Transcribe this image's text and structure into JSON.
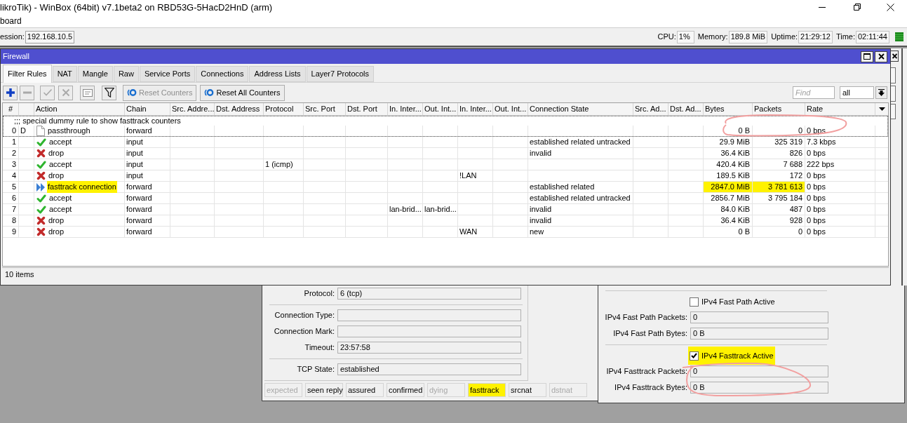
{
  "app_window": {
    "title": "likroTik) - WinBox (64bit) v7.1beta2 on RBD53G-5HacD2HnD (arm)"
  },
  "menu": [
    "board"
  ],
  "session_bar": {
    "label": "ession:",
    "value": "192.168.10.5",
    "stats": [
      {
        "label": "CPU:",
        "value": "1%"
      },
      {
        "label": "Memory:",
        "value": "189.8 MiB"
      },
      {
        "label": "Uptime:",
        "value": "21:29:12"
      },
      {
        "label": "Time:",
        "value": "02:11:44"
      }
    ]
  },
  "firewall": {
    "title": "Firewall",
    "tabs": [
      {
        "label": "Filter Rules",
        "selected": true
      },
      {
        "label": "NAT",
        "selected": false
      },
      {
        "label": "Mangle",
        "selected": false
      },
      {
        "label": "Raw",
        "selected": false
      },
      {
        "label": "Service Ports",
        "selected": false
      },
      {
        "label": "Connections",
        "selected": false
      },
      {
        "label": "Address Lists",
        "selected": false
      },
      {
        "label": "Layer7 Protocols",
        "selected": false
      }
    ],
    "toolbar": {
      "icon_buttons": [
        {
          "kind": "add",
          "disabled": false
        },
        {
          "kind": "remove",
          "disabled": true
        },
        {
          "kind": "enable",
          "disabled": true
        },
        {
          "kind": "disable",
          "disabled": true
        },
        {
          "kind": "comment",
          "disabled": true
        },
        {
          "kind": "filter",
          "disabled": false
        }
      ],
      "text_buttons": [
        {
          "label": "Reset Counters",
          "disabled": true
        },
        {
          "label": "Reset All Counters",
          "disabled": false
        }
      ],
      "find": {
        "placeholder": "Find"
      },
      "filter_select": {
        "value": "all"
      }
    },
    "table": {
      "columns": [
        "#",
        "Action",
        "Chain",
        "Src. Addre...",
        "Dst. Address",
        "Protocol",
        "Src. Port",
        "Dst. Port",
        "In. Inter...",
        "Out. Int...",
        "In. Inter...",
        "Out. Int...",
        "Connection State",
        "Src. Ad...",
        "Dst. Ad...",
        "Bytes",
        "Packets",
        "Rate"
      ],
      "rules": [
        {
          "comment": ";;; special dummy rule to show fasttrack counters",
          "num": "0",
          "flags": "D",
          "kind": "passthrough",
          "action": "passthrough",
          "chain": "forward",
          "bytes": "0 B",
          "packets": "0",
          "rate": "0 bps",
          "focused": true,
          "highlight_action": false,
          "highlight_counters": false,
          "circled": true
        },
        {
          "num": "1",
          "kind": "accept",
          "action": "accept",
          "chain": "input",
          "connection_state": "established related untracked",
          "bytes": "29.9 MiB",
          "packets": "325 319",
          "rate": "7.3 kbps",
          "focused": false,
          "highlight_action": false,
          "highlight_counters": false,
          "circled": false
        },
        {
          "num": "2",
          "kind": "drop",
          "action": "drop",
          "chain": "input",
          "connection_state": "invalid",
          "bytes": "36.4 KiB",
          "packets": "826",
          "rate": "0 bps",
          "focused": false,
          "highlight_action": false,
          "highlight_counters": false,
          "circled": false
        },
        {
          "num": "3",
          "kind": "accept",
          "action": "accept",
          "chain": "input",
          "protocol": "1 (icmp)",
          "bytes": "420.4 KiB",
          "packets": "7 688",
          "rate": "222 bps",
          "focused": false,
          "highlight_action": false,
          "highlight_counters": false,
          "circled": false
        },
        {
          "num": "4",
          "kind": "drop",
          "action": "drop",
          "chain": "input",
          "column_12": "!LAN",
          "bytes": "189.5 KiB",
          "packets": "172",
          "rate": "0 bps",
          "focused": false,
          "highlight_action": false,
          "highlight_counters": false,
          "circled": false
        },
        {
          "num": "5",
          "kind": "fasttrack",
          "action": "fasttrack connection",
          "chain": "forward",
          "connection_state": "established related",
          "bytes": "2847.0 MiB",
          "packets": "3 781 613",
          "rate": "0 bps",
          "focused": false,
          "highlight_action": true,
          "highlight_counters": true,
          "circled": false
        },
        {
          "num": "6",
          "kind": "accept",
          "action": "accept",
          "chain": "forward",
          "connection_state": "established related untracked",
          "bytes": "2856.7 MiB",
          "packets": "3 795 184",
          "rate": "0 bps",
          "focused": false,
          "highlight_action": false,
          "highlight_counters": false,
          "circled": false
        },
        {
          "num": "7",
          "kind": "accept",
          "action": "accept",
          "chain": "forward",
          "column_10": "lan-brid...",
          "column_11": "lan-brid...",
          "connection_state": "invalid",
          "bytes": "84.0 KiB",
          "packets": "487",
          "rate": "0 bps",
          "focused": false,
          "highlight_action": false,
          "highlight_counters": false,
          "circled": false
        },
        {
          "num": "8",
          "kind": "drop",
          "action": "drop",
          "chain": "forward",
          "connection_state": "invalid",
          "bytes": "36.4 KiB",
          "packets": "928",
          "rate": "0 bps",
          "focused": false,
          "highlight_action": false,
          "highlight_counters": false,
          "circled": false
        },
        {
          "num": "9",
          "kind": "drop",
          "action": "drop",
          "chain": "forward",
          "column_12": "WAN",
          "connection_state": "new",
          "bytes": "0 B",
          "packets": "0",
          "rate": "0 bps",
          "focused": false,
          "highlight_action": false,
          "highlight_counters": false,
          "circled": false
        }
      ],
      "status": "10 items"
    }
  },
  "connection_window": {
    "groups": [
      [
        {
          "label": "Protocol:",
          "value": "6 (tcp)"
        }
      ],
      [
        {
          "label": "Connection Type:"
        },
        {
          "label": "Connection Mark:"
        },
        {
          "label": "Timeout:",
          "value": "23:57:58"
        }
      ],
      [
        {
          "label": "TCP State:",
          "value": "established"
        }
      ]
    ],
    "flags": [
      {
        "label": "expected",
        "on": false,
        "highlighted": false
      },
      {
        "label": "seen reply",
        "on": true,
        "highlighted": false
      },
      {
        "label": "assured",
        "on": true,
        "highlighted": false
      },
      {
        "label": "confirmed",
        "on": true,
        "highlighted": false
      },
      {
        "label": "dying",
        "on": false,
        "highlighted": false
      },
      {
        "label": "fasttrack",
        "on": true,
        "highlighted": true
      },
      {
        "label": "srcnat",
        "on": true,
        "highlighted": false
      },
      {
        "label": "dstnat",
        "on": false,
        "highlighted": false
      }
    ]
  },
  "fast_path_window": {
    "groups": [
      {
        "checkbox": {
          "label": "IPv4 Fast Path Active",
          "checked": false,
          "highlighted": false
        },
        "circled": false,
        "fields": [
          {
            "label": "IPv4 Fast Path Packets:",
            "value": "0"
          },
          {
            "label": "IPv4 Fast Path Bytes:",
            "value": "0 B"
          }
        ]
      },
      {
        "checkbox": {
          "label": "IPv4 Fasttrack Active",
          "checked": true,
          "highlighted": true
        },
        "circled": true,
        "fields": [
          {
            "label": "IPv4 Fasttrack Packets:",
            "value": "0"
          },
          {
            "label": "IPv4 Fasttrack Bytes:",
            "value": "0 B"
          }
        ]
      }
    ]
  }
}
